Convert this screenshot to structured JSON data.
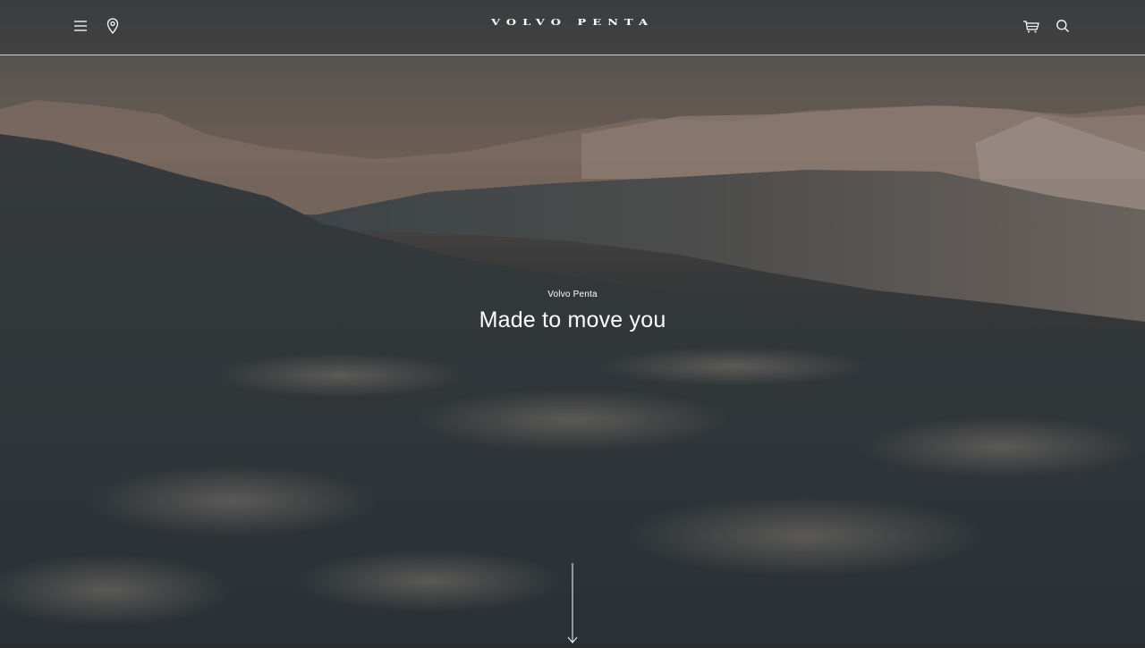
{
  "header": {
    "logo_text": "VOLVO PENTA",
    "menu_icon": "hamburger-menu-icon",
    "location_icon": "map-pin-icon",
    "cart_icon": "shopping-cart-icon",
    "search_icon": "search-icon"
  },
  "hero": {
    "eyebrow": "Volvo Penta",
    "headline": "Made to move you",
    "scroll_icon": "arrow-down-icon"
  },
  "colors": {
    "text": "#ffffff",
    "header_background": "#3c3e40",
    "header_divider": "#ffffff"
  }
}
